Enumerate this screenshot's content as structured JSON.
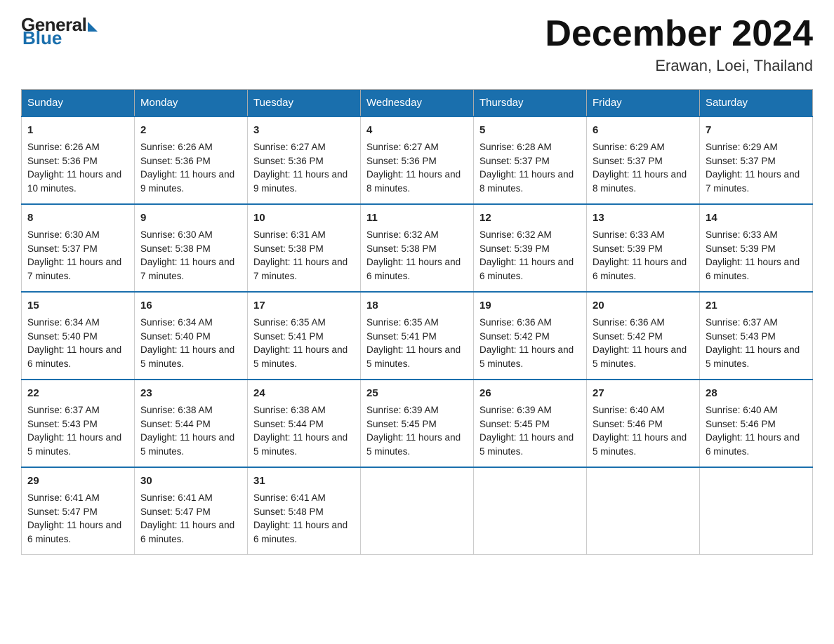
{
  "header": {
    "logo_general": "General",
    "logo_blue": "Blue",
    "month_title": "December 2024",
    "location": "Erawan, Loei, Thailand"
  },
  "days_of_week": [
    "Sunday",
    "Monday",
    "Tuesday",
    "Wednesday",
    "Thursday",
    "Friday",
    "Saturday"
  ],
  "weeks": [
    [
      {
        "day": "1",
        "sunrise": "6:26 AM",
        "sunset": "5:36 PM",
        "daylight": "11 hours and 10 minutes."
      },
      {
        "day": "2",
        "sunrise": "6:26 AM",
        "sunset": "5:36 PM",
        "daylight": "11 hours and 9 minutes."
      },
      {
        "day": "3",
        "sunrise": "6:27 AM",
        "sunset": "5:36 PM",
        "daylight": "11 hours and 9 minutes."
      },
      {
        "day": "4",
        "sunrise": "6:27 AM",
        "sunset": "5:36 PM",
        "daylight": "11 hours and 8 minutes."
      },
      {
        "day": "5",
        "sunrise": "6:28 AM",
        "sunset": "5:37 PM",
        "daylight": "11 hours and 8 minutes."
      },
      {
        "day": "6",
        "sunrise": "6:29 AM",
        "sunset": "5:37 PM",
        "daylight": "11 hours and 8 minutes."
      },
      {
        "day": "7",
        "sunrise": "6:29 AM",
        "sunset": "5:37 PM",
        "daylight": "11 hours and 7 minutes."
      }
    ],
    [
      {
        "day": "8",
        "sunrise": "6:30 AM",
        "sunset": "5:37 PM",
        "daylight": "11 hours and 7 minutes."
      },
      {
        "day": "9",
        "sunrise": "6:30 AM",
        "sunset": "5:38 PM",
        "daylight": "11 hours and 7 minutes."
      },
      {
        "day": "10",
        "sunrise": "6:31 AM",
        "sunset": "5:38 PM",
        "daylight": "11 hours and 7 minutes."
      },
      {
        "day": "11",
        "sunrise": "6:32 AM",
        "sunset": "5:38 PM",
        "daylight": "11 hours and 6 minutes."
      },
      {
        "day": "12",
        "sunrise": "6:32 AM",
        "sunset": "5:39 PM",
        "daylight": "11 hours and 6 minutes."
      },
      {
        "day": "13",
        "sunrise": "6:33 AM",
        "sunset": "5:39 PM",
        "daylight": "11 hours and 6 minutes."
      },
      {
        "day": "14",
        "sunrise": "6:33 AM",
        "sunset": "5:39 PM",
        "daylight": "11 hours and 6 minutes."
      }
    ],
    [
      {
        "day": "15",
        "sunrise": "6:34 AM",
        "sunset": "5:40 PM",
        "daylight": "11 hours and 6 minutes."
      },
      {
        "day": "16",
        "sunrise": "6:34 AM",
        "sunset": "5:40 PM",
        "daylight": "11 hours and 5 minutes."
      },
      {
        "day": "17",
        "sunrise": "6:35 AM",
        "sunset": "5:41 PM",
        "daylight": "11 hours and 5 minutes."
      },
      {
        "day": "18",
        "sunrise": "6:35 AM",
        "sunset": "5:41 PM",
        "daylight": "11 hours and 5 minutes."
      },
      {
        "day": "19",
        "sunrise": "6:36 AM",
        "sunset": "5:42 PM",
        "daylight": "11 hours and 5 minutes."
      },
      {
        "day": "20",
        "sunrise": "6:36 AM",
        "sunset": "5:42 PM",
        "daylight": "11 hours and 5 minutes."
      },
      {
        "day": "21",
        "sunrise": "6:37 AM",
        "sunset": "5:43 PM",
        "daylight": "11 hours and 5 minutes."
      }
    ],
    [
      {
        "day": "22",
        "sunrise": "6:37 AM",
        "sunset": "5:43 PM",
        "daylight": "11 hours and 5 minutes."
      },
      {
        "day": "23",
        "sunrise": "6:38 AM",
        "sunset": "5:44 PM",
        "daylight": "11 hours and 5 minutes."
      },
      {
        "day": "24",
        "sunrise": "6:38 AM",
        "sunset": "5:44 PM",
        "daylight": "11 hours and 5 minutes."
      },
      {
        "day": "25",
        "sunrise": "6:39 AM",
        "sunset": "5:45 PM",
        "daylight": "11 hours and 5 minutes."
      },
      {
        "day": "26",
        "sunrise": "6:39 AM",
        "sunset": "5:45 PM",
        "daylight": "11 hours and 5 minutes."
      },
      {
        "day": "27",
        "sunrise": "6:40 AM",
        "sunset": "5:46 PM",
        "daylight": "11 hours and 5 minutes."
      },
      {
        "day": "28",
        "sunrise": "6:40 AM",
        "sunset": "5:46 PM",
        "daylight": "11 hours and 6 minutes."
      }
    ],
    [
      {
        "day": "29",
        "sunrise": "6:41 AM",
        "sunset": "5:47 PM",
        "daylight": "11 hours and 6 minutes."
      },
      {
        "day": "30",
        "sunrise": "6:41 AM",
        "sunset": "5:47 PM",
        "daylight": "11 hours and 6 minutes."
      },
      {
        "day": "31",
        "sunrise": "6:41 AM",
        "sunset": "5:48 PM",
        "daylight": "11 hours and 6 minutes."
      },
      null,
      null,
      null,
      null
    ]
  ],
  "labels": {
    "sunrise": "Sunrise:",
    "sunset": "Sunset:",
    "daylight": "Daylight:"
  }
}
